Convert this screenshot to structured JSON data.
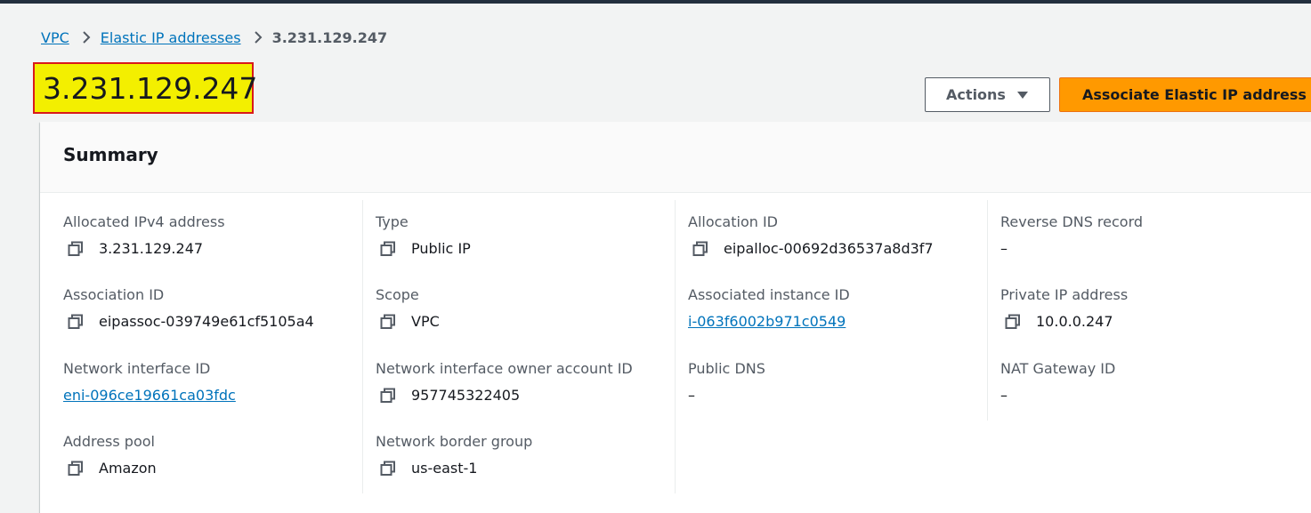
{
  "breadcrumb": {
    "items": [
      {
        "label": "VPC"
      },
      {
        "label": "Elastic IP addresses"
      },
      {
        "label": "3.231.129.247"
      }
    ]
  },
  "page": {
    "title": "3.231.129.247"
  },
  "header_actions": {
    "actions_label": "Actions",
    "associate_label": "Associate Elastic IP address",
    "associate_color": "#ff9900"
  },
  "summary": {
    "title": "Summary",
    "fields": {
      "allocated_ipv4": {
        "label": "Allocated IPv4 address",
        "value": "3.231.129.247"
      },
      "type": {
        "label": "Type",
        "value": "Public IP"
      },
      "allocation_id": {
        "label": "Allocation ID",
        "value": "eipalloc-00692d36537a8d3f7"
      },
      "reverse_dns": {
        "label": "Reverse DNS record",
        "value": "–"
      },
      "association_id": {
        "label": "Association ID",
        "value": "eipassoc-039749e61cf5105a4"
      },
      "scope": {
        "label": "Scope",
        "value": "VPC"
      },
      "associated_instance": {
        "label": "Associated instance ID",
        "value": "i-063f6002b971c0549"
      },
      "private_ip": {
        "label": "Private IP address",
        "value": "10.0.0.247"
      },
      "network_interface_id": {
        "label": "Network interface ID",
        "value": "eni-096ce19661ca03fdc"
      },
      "ni_owner": {
        "label": "Network interface owner account ID",
        "value": "957745322405"
      },
      "public_dns": {
        "label": "Public DNS",
        "value": "–"
      },
      "nat_gateway": {
        "label": "NAT Gateway ID",
        "value": "–"
      },
      "address_pool": {
        "label": "Address pool",
        "value": "Amazon"
      },
      "border_group": {
        "label": "Network border group",
        "value": "us-east-1"
      }
    }
  },
  "icons": {
    "copy": "copy-icon",
    "breadcrumb_separator": "chevron-right-icon",
    "dropdown": "caret-down-icon"
  },
  "colors": {
    "link": "#0073bb",
    "highlight": "#f3ef00",
    "highlight_border": "#d91a1a"
  }
}
